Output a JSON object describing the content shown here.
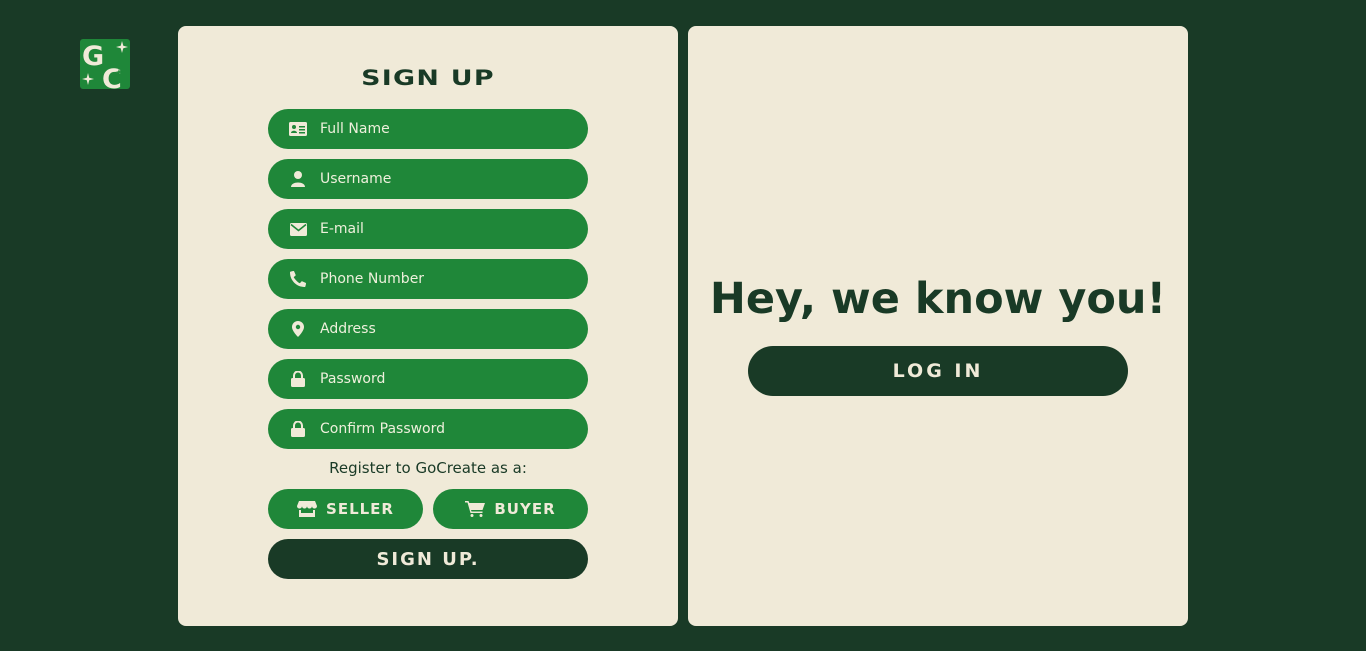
{
  "app": {
    "logo_text": "GC",
    "brand_color": "#1f8739",
    "background_color": "#193a26",
    "panel_color": "#f0ead8"
  },
  "signup": {
    "title": "SIGN UP",
    "fields": [
      {
        "icon": "id-card-icon",
        "placeholder": "Full Name",
        "value": ""
      },
      {
        "icon": "user-icon",
        "placeholder": "Username",
        "value": ""
      },
      {
        "icon": "envelope-icon",
        "placeholder": "E-mail",
        "value": ""
      },
      {
        "icon": "phone-icon",
        "placeholder": "Phone Number",
        "value": ""
      },
      {
        "icon": "location-pin-icon",
        "placeholder": "Address",
        "value": ""
      },
      {
        "icon": "lock-icon",
        "placeholder": "Password",
        "value": ""
      },
      {
        "icon": "lock-icon",
        "placeholder": "Confirm Password",
        "value": ""
      }
    ],
    "register_label": "Register to GoCreate as a:",
    "roles": [
      {
        "icon": "store-icon",
        "label": "SELLER"
      },
      {
        "icon": "cart-icon",
        "label": "BUYER"
      }
    ],
    "submit_label": "SIGN UP."
  },
  "login_panel": {
    "heading": "Hey, we know you!",
    "login_label": "LOG IN"
  }
}
